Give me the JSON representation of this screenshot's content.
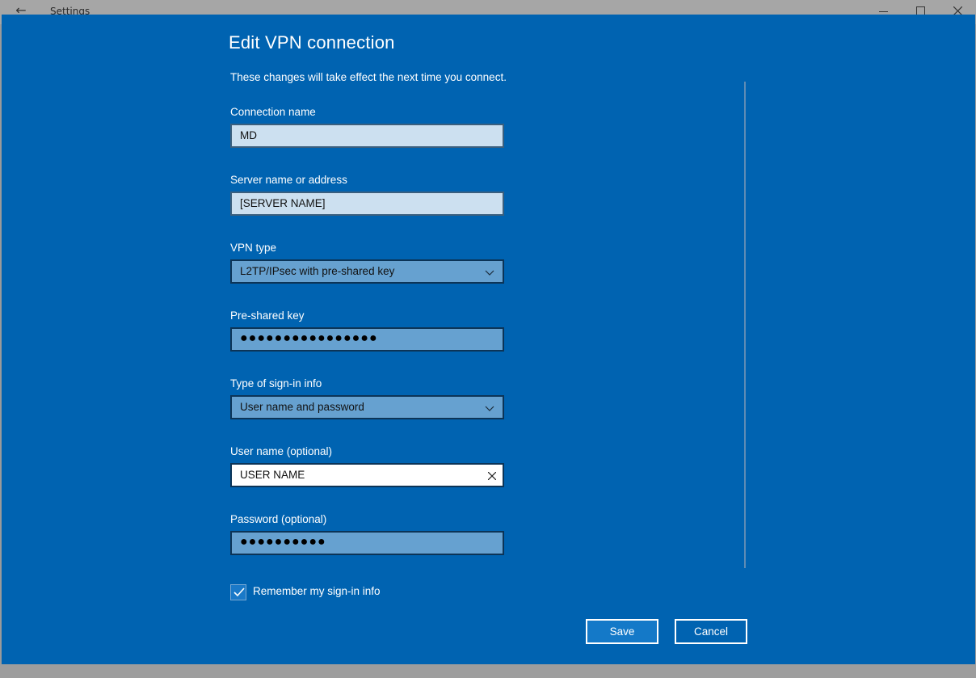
{
  "window": {
    "title": "Settings"
  },
  "dialog": {
    "title": "Edit VPN connection",
    "subtitle": "These changes will take effect the next time you connect."
  },
  "fields": {
    "connection_name": {
      "label": "Connection name",
      "value": "MD"
    },
    "server": {
      "label": "Server name or address",
      "value": "[SERVER NAME]"
    },
    "vpn_type": {
      "label": "VPN type",
      "value": "L2TP/IPsec with pre-shared key"
    },
    "preshared_key": {
      "label": "Pre-shared key",
      "value": "●●●●●●●●●●●●●●●●"
    },
    "signin_type": {
      "label": "Type of sign-in info",
      "value": "User name and password"
    },
    "username": {
      "label": "User name (optional)",
      "value": "USER NAME"
    },
    "password": {
      "label": "Password (optional)",
      "value": "●●●●●●●●●●"
    }
  },
  "remember": {
    "label": "Remember my sign-in info",
    "checked": true
  },
  "buttons": {
    "save": "Save",
    "cancel": "Cancel"
  },
  "colors": {
    "dialog_bg": "#0063b1",
    "accent": "#1479c8"
  }
}
